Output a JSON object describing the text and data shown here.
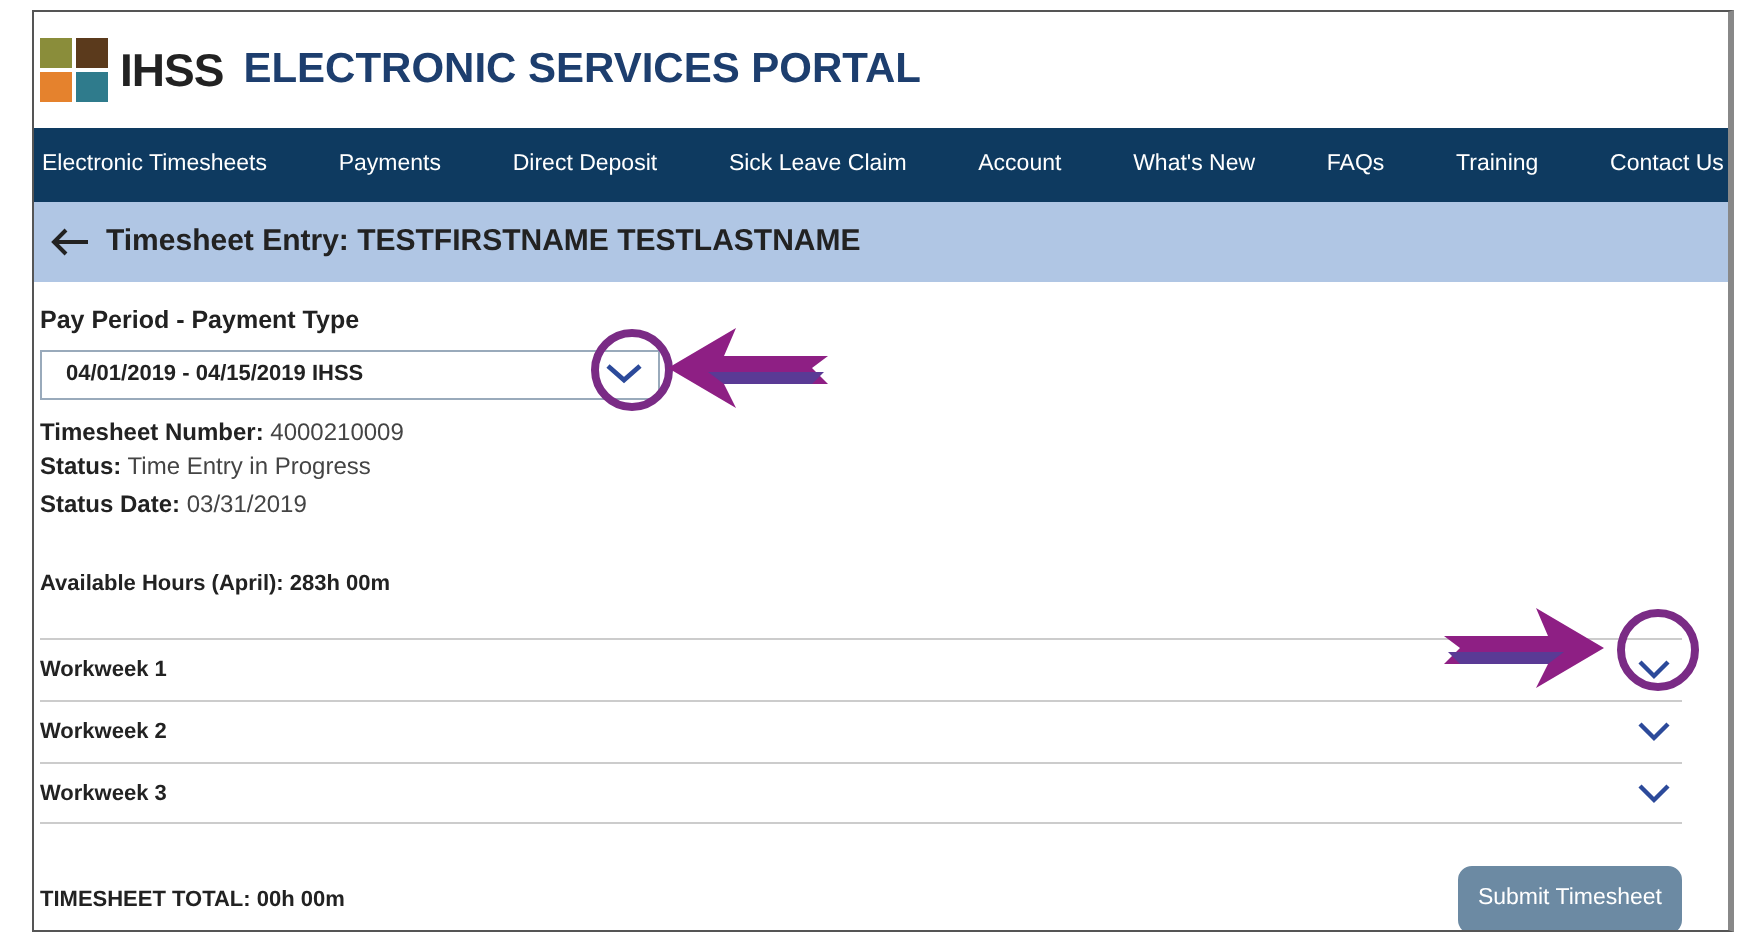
{
  "header": {
    "logo_text": "IHSS",
    "title": "ELECTRONIC SERVICES PORTAL"
  },
  "nav": [
    "Electronic Timesheets",
    "Payments",
    "Direct Deposit",
    "Sick Leave Claim",
    "Account",
    "What's New",
    "FAQs",
    "Training",
    "Contact Us"
  ],
  "page_title": "Timesheet Entry: TESTFIRSTNAME TESTLASTNAME",
  "pay_period": {
    "label": "Pay Period - Payment Type",
    "value": "04/01/2019 - 04/15/2019 IHSS",
    "highlighted": true
  },
  "details": [
    {
      "label": "Timesheet Number:",
      "value": "4000210009"
    },
    {
      "label": "Status:",
      "value": "Time Entry in Progress"
    },
    {
      "label": "Status Date:",
      "value": "03/31/2019"
    }
  ],
  "available_hours": "Available Hours (April): 283h 00m",
  "workweeks": [
    {
      "label": "Workweek 1",
      "expanded": false,
      "highlighted": true
    },
    {
      "label": "Workweek 2",
      "expanded": false,
      "highlighted": false
    },
    {
      "label": "Workweek 3",
      "expanded": false,
      "highlighted": false
    }
  ],
  "total": "TIMESHEET TOTAL: 00h 00m",
  "submit": {
    "label": "Submit Timesheet",
    "disabled": true
  }
}
